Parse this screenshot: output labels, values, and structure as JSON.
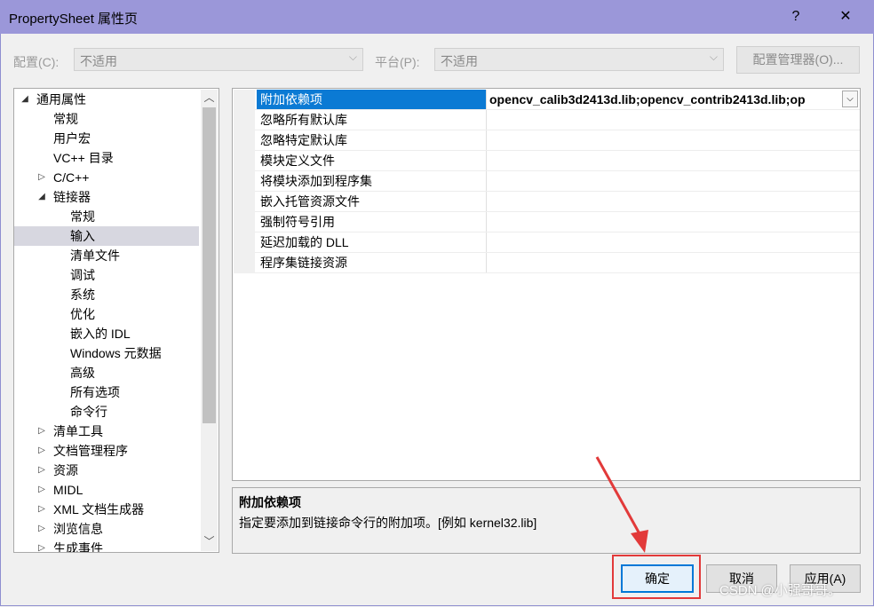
{
  "window": {
    "title": "PropertySheet 属性页",
    "help_btn": "?",
    "close_btn": "✕"
  },
  "toolbar": {
    "config_label": "配置(C):",
    "config_value": "不适用",
    "platform_label": "平台(P):",
    "platform_value": "不适用",
    "config_manager_btn": "配置管理器(O)..."
  },
  "tree": {
    "items": [
      {
        "label": "通用属性",
        "expander": "◢",
        "indent": 0
      },
      {
        "label": "常规",
        "expander": "",
        "indent": 1
      },
      {
        "label": "用户宏",
        "expander": "",
        "indent": 1
      },
      {
        "label": "VC++ 目录",
        "expander": "",
        "indent": 1
      },
      {
        "label": "C/C++",
        "expander": "▷",
        "indent": 1
      },
      {
        "label": "链接器",
        "expander": "◢",
        "indent": 1
      },
      {
        "label": "常规",
        "expander": "",
        "indent": 2
      },
      {
        "label": "输入",
        "expander": "",
        "indent": 2,
        "selected": true
      },
      {
        "label": "清单文件",
        "expander": "",
        "indent": 2
      },
      {
        "label": "调试",
        "expander": "",
        "indent": 2
      },
      {
        "label": "系统",
        "expander": "",
        "indent": 2
      },
      {
        "label": "优化",
        "expander": "",
        "indent": 2
      },
      {
        "label": "嵌入的 IDL",
        "expander": "",
        "indent": 2
      },
      {
        "label": "Windows 元数据",
        "expander": "",
        "indent": 2
      },
      {
        "label": "高级",
        "expander": "",
        "indent": 2
      },
      {
        "label": "所有选项",
        "expander": "",
        "indent": 2
      },
      {
        "label": "命令行",
        "expander": "",
        "indent": 2
      },
      {
        "label": "清单工具",
        "expander": "▷",
        "indent": 1
      },
      {
        "label": "文档管理程序",
        "expander": "▷",
        "indent": 1
      },
      {
        "label": "资源",
        "expander": "▷",
        "indent": 1
      },
      {
        "label": "MIDL",
        "expander": "▷",
        "indent": 1
      },
      {
        "label": "XML 文档生成器",
        "expander": "▷",
        "indent": 1
      },
      {
        "label": "浏览信息",
        "expander": "▷",
        "indent": 1
      },
      {
        "label": "生成事件",
        "expander": "▷",
        "indent": 1
      }
    ]
  },
  "grid": {
    "rows": [
      {
        "name": "附加依赖项",
        "value": "opencv_calib3d2413d.lib;opencv_contrib2413d.lib;op",
        "selected": true
      },
      {
        "name": "忽略所有默认库",
        "value": ""
      },
      {
        "name": "忽略特定默认库",
        "value": ""
      },
      {
        "name": "模块定义文件",
        "value": ""
      },
      {
        "name": "将模块添加到程序集",
        "value": ""
      },
      {
        "name": "嵌入托管资源文件",
        "value": ""
      },
      {
        "name": "强制符号引用",
        "value": ""
      },
      {
        "name": "延迟加载的 DLL",
        "value": ""
      },
      {
        "name": "程序集链接资源",
        "value": ""
      }
    ]
  },
  "description": {
    "title": "附加依赖项",
    "text": "指定要添加到链接命令行的附加项。[例如 kernel32.lib]"
  },
  "buttons": {
    "ok": "确定",
    "cancel": "取消",
    "apply": "应用(A)"
  },
  "watermark": "CSDN @小强哥哥。",
  "colors": {
    "titlebar": "#9b97d9",
    "selection": "#0b7ad4",
    "highlight_box": "#e23a3a"
  }
}
